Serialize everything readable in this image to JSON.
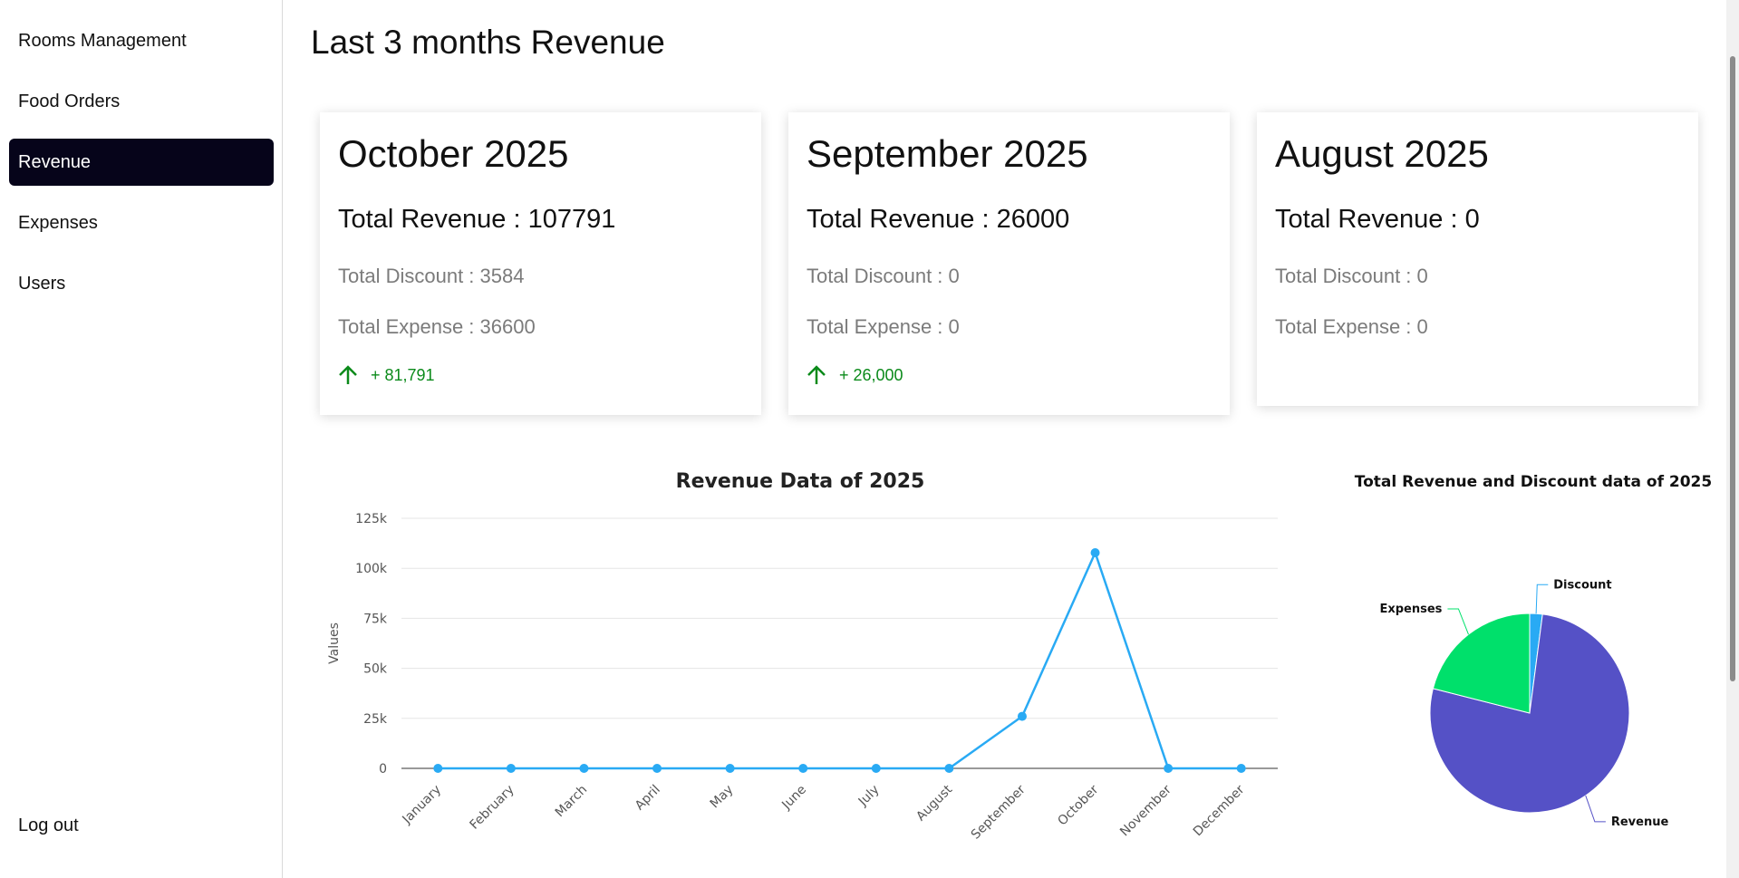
{
  "sidebar": {
    "items": [
      {
        "label": "Rooms Management",
        "active": false
      },
      {
        "label": "Food Orders",
        "active": false
      },
      {
        "label": "Revenue",
        "active": true
      },
      {
        "label": "Expenses",
        "active": false
      },
      {
        "label": "Users",
        "active": false
      }
    ],
    "logout_label": "Log out"
  },
  "main": {
    "title": "Last 3 months Revenue",
    "cards": [
      {
        "month": "October 2025",
        "total": "Total Revenue : 107791",
        "discount": "Total Discount : 3584",
        "expense": "Total Expense : 36600",
        "growth": "+ 81,791"
      },
      {
        "month": "September 2025",
        "total": "Total Revenue : 26000",
        "discount": "Total Discount : 0",
        "expense": "Total Expense : 0",
        "growth": "+ 26,000"
      },
      {
        "month": "August 2025",
        "total": "Total Revenue : 0",
        "discount": "Total Discount : 0",
        "expense": "Total Expense : 0",
        "growth": ""
      }
    ]
  },
  "colors": {
    "active_nav": "#06041a",
    "growth_green": "#0b8a1a",
    "line": "#29aaf4",
    "pie_revenue": "#5551c6",
    "pie_expenses": "#00e06b",
    "pie_discount": "#29aaf4"
  },
  "chart_data": [
    {
      "type": "line",
      "title": "Revenue Data of 2025",
      "ylabel": "Values",
      "xlabel": "",
      "categories": [
        "January",
        "February",
        "March",
        "April",
        "May",
        "June",
        "July",
        "August",
        "September",
        "October",
        "November",
        "December"
      ],
      "series": [
        {
          "name": "Revenue Data",
          "values": [
            0,
            0,
            0,
            0,
            0,
            0,
            0,
            0,
            26000,
            107791,
            0,
            0
          ]
        }
      ],
      "ylim": [
        0,
        125000
      ],
      "yticks": [
        "0",
        "25k",
        "50k",
        "75k",
        "100k",
        "125k"
      ],
      "grid": true,
      "legend": "bottom"
    },
    {
      "type": "pie",
      "title": "Total Revenue and Discount data of 2025",
      "slices": [
        {
          "label": "Discount",
          "value": 3584
        },
        {
          "label": "Revenue",
          "value": 133791
        },
        {
          "label": "Expenses",
          "value": 36600
        }
      ]
    }
  ]
}
